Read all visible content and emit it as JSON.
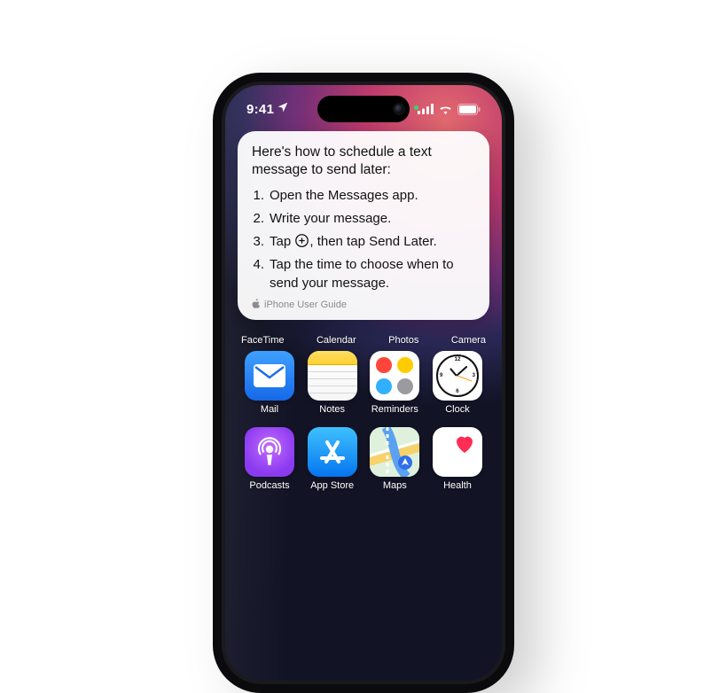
{
  "status": {
    "time": "9:41",
    "location_icon": "location-arrow-icon",
    "signal_bars": 4,
    "wifi_bars": 3,
    "battery_pct": 100
  },
  "card": {
    "title": "Here's how to schedule a text message to send later:",
    "steps": [
      {
        "num": "1.",
        "text": "Open the Messages app."
      },
      {
        "num": "2.",
        "text": "Write your message."
      },
      {
        "num": "3.",
        "pre": "Tap ",
        "icon": "plus-circle-icon",
        "post": ", then tap Send Later."
      },
      {
        "num": "4.",
        "text": "Tap the time to choose when to send your message."
      }
    ],
    "source": "iPhone User Guide"
  },
  "peek_labels": [
    "FaceTime",
    "Calendar",
    "Photos",
    "Camera"
  ],
  "rows": [
    [
      {
        "name": "mail",
        "label": "Mail"
      },
      {
        "name": "notes",
        "label": "Notes"
      },
      {
        "name": "reminders",
        "label": "Reminders"
      },
      {
        "name": "clock",
        "label": "Clock"
      }
    ],
    [
      {
        "name": "podcasts",
        "label": "Podcasts"
      },
      {
        "name": "appstore",
        "label": "App Store"
      },
      {
        "name": "maps",
        "label": "Maps"
      },
      {
        "name": "health",
        "label": "Health"
      }
    ]
  ]
}
